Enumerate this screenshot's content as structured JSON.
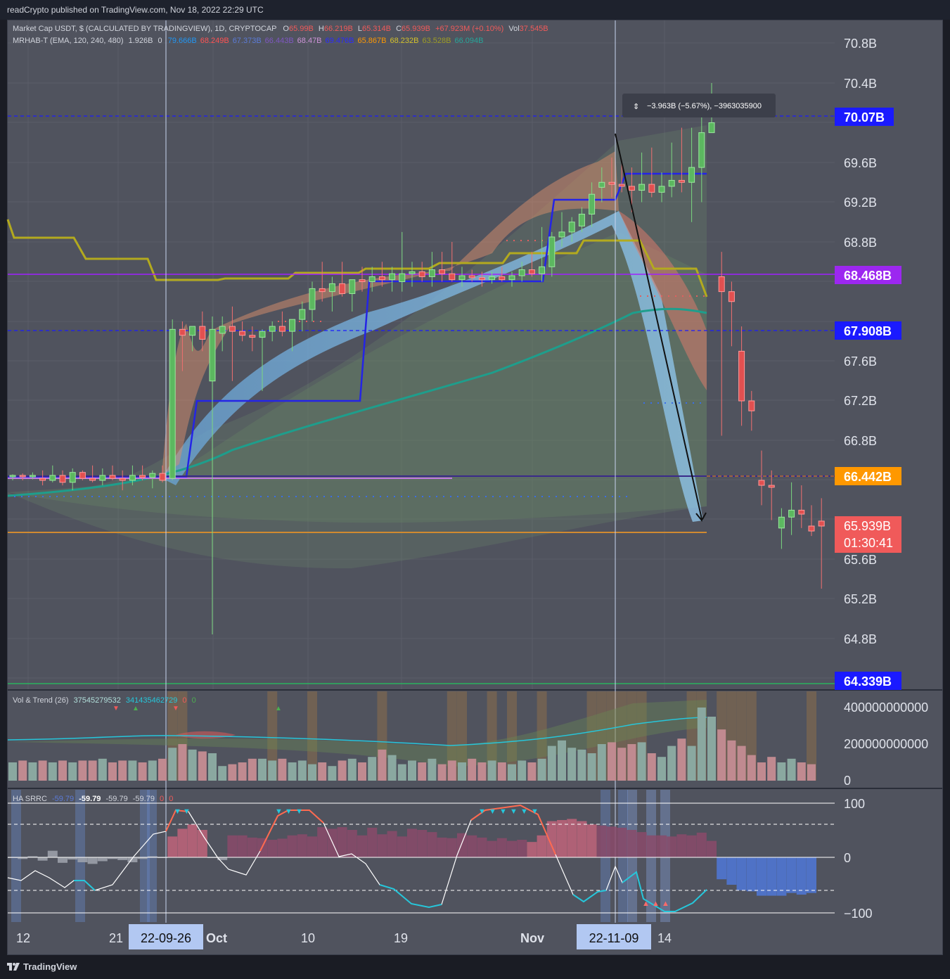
{
  "header": {
    "publisher_line": "readCrypto published on TradingView.com, Nov 18, 2022 22:29 UTC"
  },
  "footer": {
    "brand": "TradingView"
  },
  "legend_main": {
    "symbol": "Market Cap USDT, $ (CALCULATED BY TRADINGVIEW), 1D, CRYPTOCAP",
    "o_label": "O",
    "o": "65.99B",
    "h_label": "H",
    "h": "66.219B",
    "l_label": "L",
    "l": "65.314B",
    "c_label": "C",
    "c": "65.939B",
    "chg": "+67.923M (+0.10%)",
    "vol_label": "Vol",
    "vol": "37.545B"
  },
  "legend_mrhab": {
    "name": "MRHAB-T (EMA, 120, 240, 480)",
    "v1": "1.926B",
    "v1_sep": "0",
    "values": [
      {
        "text": "79.666B",
        "color": "#2196f3"
      },
      {
        "text": "68.249B",
        "color": "#ff5252"
      },
      {
        "text": "67.373B",
        "color": "#5b7bd8"
      },
      {
        "text": "66.443B",
        "color": "#7e57c2"
      },
      {
        "text": "68.47B",
        "color": "#ce93d8"
      },
      {
        "text": "69.476B",
        "color": "#2b2bff"
      },
      {
        "text": "65.867B",
        "color": "#ff9800"
      },
      {
        "text": "68.232B",
        "color": "#d4c22b"
      },
      {
        "text": "63.528B",
        "color": "#9e9d24"
      },
      {
        "text": "66.094B",
        "color": "#26a69a"
      }
    ]
  },
  "legend_vol": {
    "name": "Vol & Trend (26)",
    "v1": "37545279532",
    "v2": "341435462729",
    "v3": "0",
    "v4": "0"
  },
  "legend_ha": {
    "name": "HA SRRC",
    "v0": "-59.79",
    "v1": "-59.79",
    "v2": "-59.79",
    "v3": "-59.79",
    "v4": "0",
    "v5": "0"
  },
  "measure_tooltip": "−3.963B (−5.67%), −3963035900",
  "price_axis": {
    "ticks": [
      "70.8B",
      "70.4B",
      "69.6B",
      "69.2B",
      "68.8B",
      "67.6B",
      "67.2B",
      "66.8B",
      "65.6B",
      "65.2B",
      "64.8B"
    ],
    "badges": [
      {
        "label": "70.07B",
        "color": "#1a1aff"
      },
      {
        "label": "68.468B",
        "color": "#9c27f0"
      },
      {
        "label": "67.908B",
        "color": "#1a1aff"
      },
      {
        "label": "66.442B",
        "color": "#ff9800"
      },
      {
        "label": "65.939B",
        "color": "#f05a5a"
      },
      {
        "label": "64.339B",
        "color": "#1a1aff"
      }
    ],
    "countdown": "01:30:41"
  },
  "vol_axis": {
    "ticks": [
      "400000000000",
      "200000000000",
      "0"
    ]
  },
  "osc_axis": {
    "ticks": [
      "100",
      "0",
      "−100"
    ]
  },
  "time_axis": {
    "labels": [
      "12",
      "21",
      "Oct",
      "10",
      "19",
      "Nov",
      "14"
    ],
    "cursor_labels": [
      "22-09-26",
      "22-11-09"
    ]
  },
  "chart_data": {
    "type": "candlestick",
    "title": "Market Cap USDT, $ (CALCULATED BY TRADINGVIEW), 1D, CRYPTOCAP",
    "unit": "B",
    "ylim": [
      64.3,
      71.0
    ],
    "x_start_label": "12",
    "candles": [
      [
        66.44,
        66.46,
        66.4,
        66.45
      ],
      [
        66.45,
        66.47,
        66.4,
        66.44
      ],
      [
        66.44,
        66.48,
        66.41,
        66.45
      ],
      [
        66.42,
        66.5,
        66.35,
        66.4
      ],
      [
        66.4,
        66.55,
        66.38,
        66.45
      ],
      [
        66.45,
        66.5,
        66.35,
        66.38
      ],
      [
        66.38,
        66.52,
        66.3,
        66.48
      ],
      [
        66.48,
        66.5,
        66.4,
        66.42
      ],
      [
        66.42,
        66.55,
        66.38,
        66.4
      ],
      [
        66.4,
        66.52,
        66.35,
        66.45
      ],
      [
        66.45,
        66.55,
        66.4,
        66.42
      ],
      [
        66.42,
        66.5,
        66.3,
        66.4
      ],
      [
        66.4,
        66.55,
        66.35,
        66.45
      ],
      [
        66.45,
        66.55,
        66.4,
        66.43
      ],
      [
        66.43,
        66.5,
        66.32,
        66.47
      ],
      [
        66.47,
        66.55,
        66.38,
        66.4
      ],
      [
        66.42,
        68.02,
        66.4,
        67.92
      ],
      [
        67.92,
        68.0,
        67.5,
        67.86
      ],
      [
        67.86,
        67.95,
        67.7,
        67.95
      ],
      [
        67.95,
        68.1,
        67.7,
        67.82
      ],
      [
        67.4,
        68.05,
        64.85,
        67.92
      ],
      [
        67.88,
        68.05,
        67.7,
        67.95
      ],
      [
        67.95,
        68.15,
        67.4,
        67.9
      ],
      [
        67.9,
        68.0,
        67.8,
        67.86
      ],
      [
        67.86,
        67.95,
        67.7,
        67.84
      ],
      [
        67.84,
        67.92,
        67.3,
        67.9
      ],
      [
        67.9,
        68.0,
        67.8,
        67.95
      ],
      [
        67.95,
        68.1,
        67.85,
        67.9
      ],
      [
        67.9,
        68.0,
        67.7,
        68.02
      ],
      [
        68.02,
        68.2,
        67.9,
        68.12
      ],
      [
        68.12,
        68.4,
        68.0,
        68.33
      ],
      [
        68.33,
        68.6,
        68.2,
        68.3
      ],
      [
        68.3,
        68.45,
        68.1,
        68.38
      ],
      [
        68.38,
        68.6,
        68.25,
        68.28
      ],
      [
        68.28,
        68.4,
        68.1,
        68.42
      ],
      [
        68.42,
        68.55,
        68.3,
        68.4
      ],
      [
        68.4,
        68.55,
        68.3,
        68.45
      ],
      [
        68.45,
        68.6,
        68.35,
        68.42
      ],
      [
        68.42,
        68.55,
        68.3,
        68.48
      ],
      [
        68.4,
        68.9,
        68.3,
        68.48
      ],
      [
        68.48,
        68.6,
        68.35,
        68.5
      ],
      [
        68.5,
        68.6,
        68.4,
        68.45
      ],
      [
        68.45,
        68.7,
        68.35,
        68.52
      ],
      [
        68.52,
        68.7,
        68.4,
        68.48
      ],
      [
        68.48,
        68.8,
        68.4,
        68.42
      ],
      [
        68.42,
        68.55,
        68.35,
        68.46
      ],
      [
        68.46,
        68.52,
        68.4,
        68.44
      ],
      [
        68.44,
        68.5,
        68.35,
        68.42
      ],
      [
        68.42,
        68.5,
        68.38,
        68.45
      ],
      [
        68.45,
        68.55,
        68.4,
        68.42
      ],
      [
        68.42,
        68.5,
        68.35,
        68.46
      ],
      [
        68.46,
        68.6,
        68.4,
        68.52
      ],
      [
        68.52,
        68.7,
        68.45,
        68.48
      ],
      [
        68.48,
        68.95,
        68.4,
        68.55
      ],
      [
        68.55,
        68.9,
        68.45,
        68.85
      ],
      [
        68.85,
        69.1,
        68.75,
        68.9
      ],
      [
        68.9,
        69.05,
        68.8,
        69.0
      ],
      [
        68.96,
        69.15,
        68.9,
        69.08
      ],
      [
        69.08,
        69.4,
        68.95,
        69.28
      ],
      [
        69.35,
        69.55,
        69.2,
        69.4
      ],
      [
        69.4,
        69.65,
        69.25,
        69.38
      ],
      [
        69.38,
        69.6,
        69.3,
        69.36
      ],
      [
        69.36,
        69.55,
        69.1,
        69.32
      ],
      [
        69.32,
        69.7,
        69.2,
        69.38
      ],
      [
        69.38,
        69.75,
        69.25,
        69.3
      ],
      [
        69.3,
        69.5,
        69.2,
        69.36
      ],
      [
        69.36,
        69.8,
        69.25,
        69.42
      ],
      [
        69.42,
        69.95,
        69.3,
        69.4
      ],
      [
        69.4,
        69.95,
        69.0,
        69.55
      ],
      [
        69.55,
        70.1,
        69.2,
        69.9
      ],
      [
        69.9,
        70.4,
        69.95,
        70.0
      ],
      [
        68.45,
        68.7,
        66.85,
        68.3
      ],
      [
        68.3,
        68.4,
        67.75,
        68.2
      ],
      [
        67.7,
        67.95,
        66.95,
        67.2
      ],
      [
        67.2,
        67.3,
        66.9,
        67.1
      ],
      [
        66.4,
        66.7,
        66.15,
        66.35
      ],
      [
        66.35,
        66.5,
        66.0,
        66.33
      ],
      [
        65.92,
        66.12,
        65.71,
        66.03
      ],
      [
        66.03,
        66.38,
        65.85,
        66.1
      ],
      [
        66.1,
        66.35,
        65.92,
        66.06
      ],
      [
        65.94,
        66.15,
        65.84,
        65.89
      ],
      [
        65.99,
        66.22,
        65.31,
        65.94
      ]
    ],
    "series": [
      {
        "name": "MRHAB-T (EMA, 120, 240, 480)"
      },
      {
        "name": "Vol & Trend (26)"
      },
      {
        "name": "HA SRRC"
      }
    ],
    "vol_ylim": [
      0,
      400000000000
    ],
    "osc_ylim": [
      -100,
      100
    ]
  }
}
